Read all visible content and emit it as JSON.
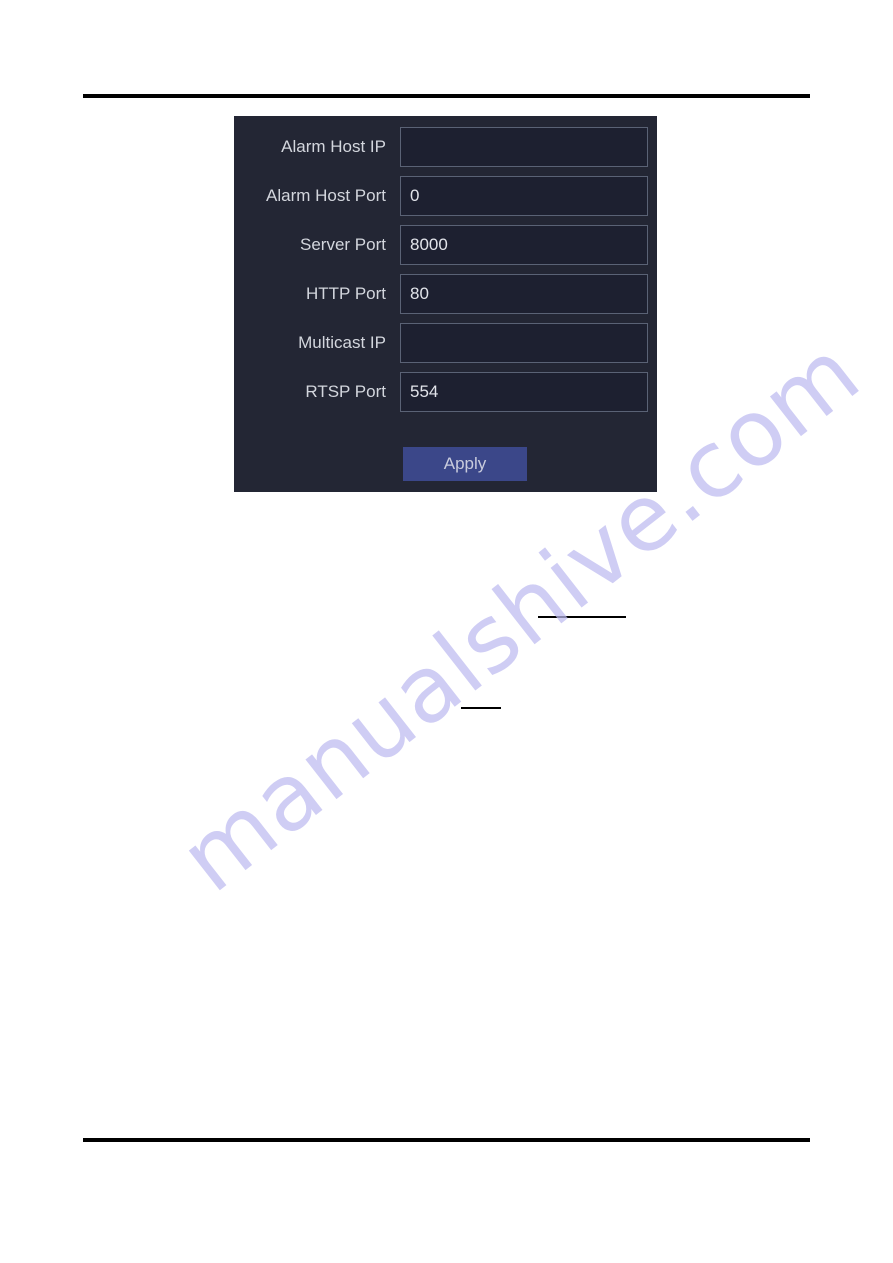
{
  "page": {
    "background_color": "#ffffff",
    "rule_color": "#000000"
  },
  "watermark": {
    "text": "manualshive.com",
    "color": "#bdbbf0"
  },
  "dialog": {
    "background_color": "#232634",
    "field_background_color": "#1d2030",
    "field_border_color": "#5a6275",
    "label_color": "#d3d6dd",
    "rows": [
      {
        "label": "Alarm Host IP",
        "value": ""
      },
      {
        "label": "Alarm Host Port",
        "value": "0"
      },
      {
        "label": "Server Port",
        "value": "8000"
      },
      {
        "label": "HTTP Port",
        "value": "80"
      },
      {
        "label": "Multicast IP",
        "value": ""
      },
      {
        "label": "RTSP Port",
        "value": "554"
      }
    ],
    "apply": {
      "label": "Apply",
      "background_color": "#3b4789",
      "text_color": "#c9ccdd"
    }
  }
}
